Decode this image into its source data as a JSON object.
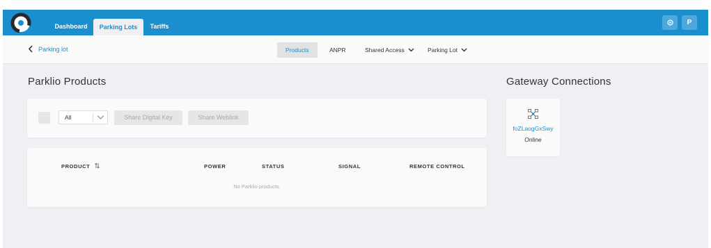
{
  "topbar": {
    "tabs": [
      {
        "label": "Dashboard"
      },
      {
        "label": "Parking Lots"
      },
      {
        "label": "Tariffs"
      }
    ],
    "user_initial": "P",
    "brand_color": "#1b8fcd",
    "settings_icon": "gear-icon"
  },
  "subbar": {
    "back_label": "Parking lot",
    "tabs": [
      {
        "label": "Products"
      },
      {
        "label": "ANPR"
      },
      {
        "label": "Shared Access"
      },
      {
        "label": "Parking Lot"
      }
    ]
  },
  "products": {
    "title": "Parklio Products",
    "filter_value": "All",
    "share_key_label": "Share Digital Key",
    "share_weblink_label": "Share Weblink",
    "columns": [
      "PRODUCT",
      "POWER",
      "STATUS",
      "SIGNAL",
      "REMOTE CONTROL"
    ],
    "empty_message": "No Parklio products."
  },
  "gateways": {
    "title": "Gateway Connections",
    "items": [
      {
        "name": "foZLaogGxSwy",
        "status": "Online"
      }
    ]
  }
}
